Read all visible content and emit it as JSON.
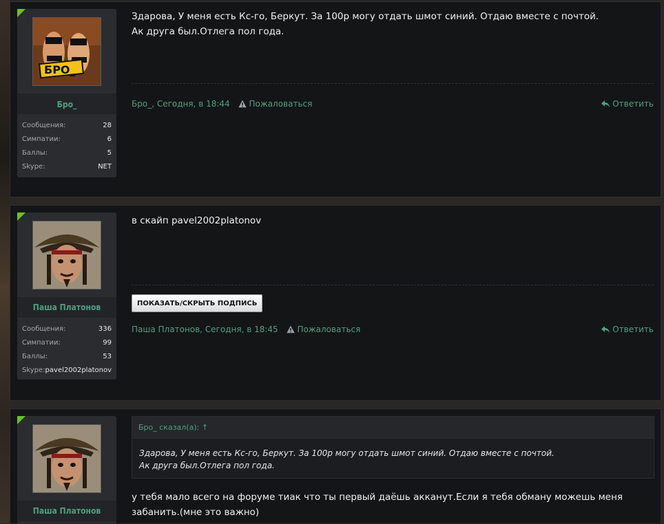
{
  "posts": [
    {
      "author": "Бро_",
      "avatar_label": "БРО_",
      "stats": [
        {
          "label": "Сообщения:",
          "value": "28"
        },
        {
          "label": "Симпатии:",
          "value": "6"
        },
        {
          "label": "Баллы:",
          "value": "5"
        },
        {
          "label": "Skype:",
          "value": "NET"
        }
      ],
      "message_lines": [
        "Здарова, У меня есть Кс-го, Беркут. За 100р могу отдать шмот синий. Отдаю вместе с почтой.",
        "Ак друга был.Отлега пол года."
      ],
      "meta_author_time": "Бро_, Сегодня, в 18:44",
      "report_label": "Пожаловаться",
      "reply_label": "Ответить"
    },
    {
      "author": "Паша Платонов",
      "stats": [
        {
          "label": "Сообщения:",
          "value": "336"
        },
        {
          "label": "Симпатии:",
          "value": "99"
        },
        {
          "label": "Баллы:",
          "value": "53"
        },
        {
          "label": "Skype:",
          "value": "pavel2002platonov"
        }
      ],
      "message_lines": [
        "в скайп pavel2002platonov"
      ],
      "signature_button": "ПОКАЗАТЬ/СКРЫТЬ ПОДПИСЬ",
      "meta_author_time": "Паша Платонов, Сегодня, в 18:45",
      "report_label": "Пожаловаться",
      "reply_label": "Ответить"
    },
    {
      "author": "Паша Платонов",
      "quote": {
        "author": "Бро_ сказал(а): ↑",
        "lines": [
          "Здарова, У меня есть Кс-го, Беркут. За 100р могу отдать шмот синий. Отдаю вместе с почтой.",
          "Ак друга был.Отлега пол года."
        ]
      },
      "message_lines": [
        "у тебя мало всего на форуме тиак что ты первый даёшь акканут.Если я тебя обману можешь меня",
        "забанить.(мне это важно)"
      ]
    }
  ],
  "colors": {
    "accent_green": "#4fa07e",
    "corner_green": "#6cbf2a",
    "panel_bg": "#141517"
  },
  "icons": [
    "warning-icon",
    "reply-arrow-icon"
  ]
}
